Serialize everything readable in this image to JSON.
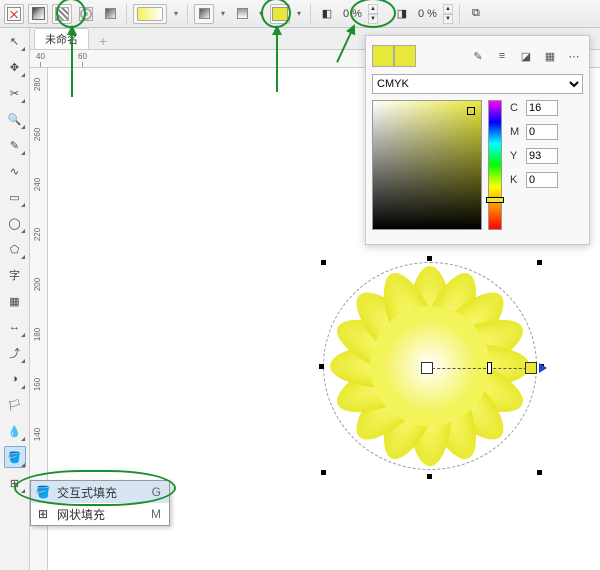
{
  "tab": {
    "doc_name": "未命名",
    "add": "+"
  },
  "toolbar": {
    "pct1": "0 %",
    "pct2": "0 %"
  },
  "picker": {
    "mode": "CMYK",
    "swatch1": "#e8e83b",
    "swatch2": "#e8e83b",
    "C_label": "C",
    "C_val": "16",
    "M_label": "M",
    "M_val": "0",
    "Y_label": "Y",
    "Y_val": "93",
    "K_label": "K",
    "K_val": "0"
  },
  "flyout": {
    "item1": "交互式填充",
    "sc1": "G",
    "item2": "网状填充",
    "sc2": "M"
  },
  "ruler_h": [
    "40",
    "60"
  ],
  "ruler_v": [
    "280",
    "260",
    "240",
    "220",
    "200",
    "180",
    "160",
    "140"
  ]
}
